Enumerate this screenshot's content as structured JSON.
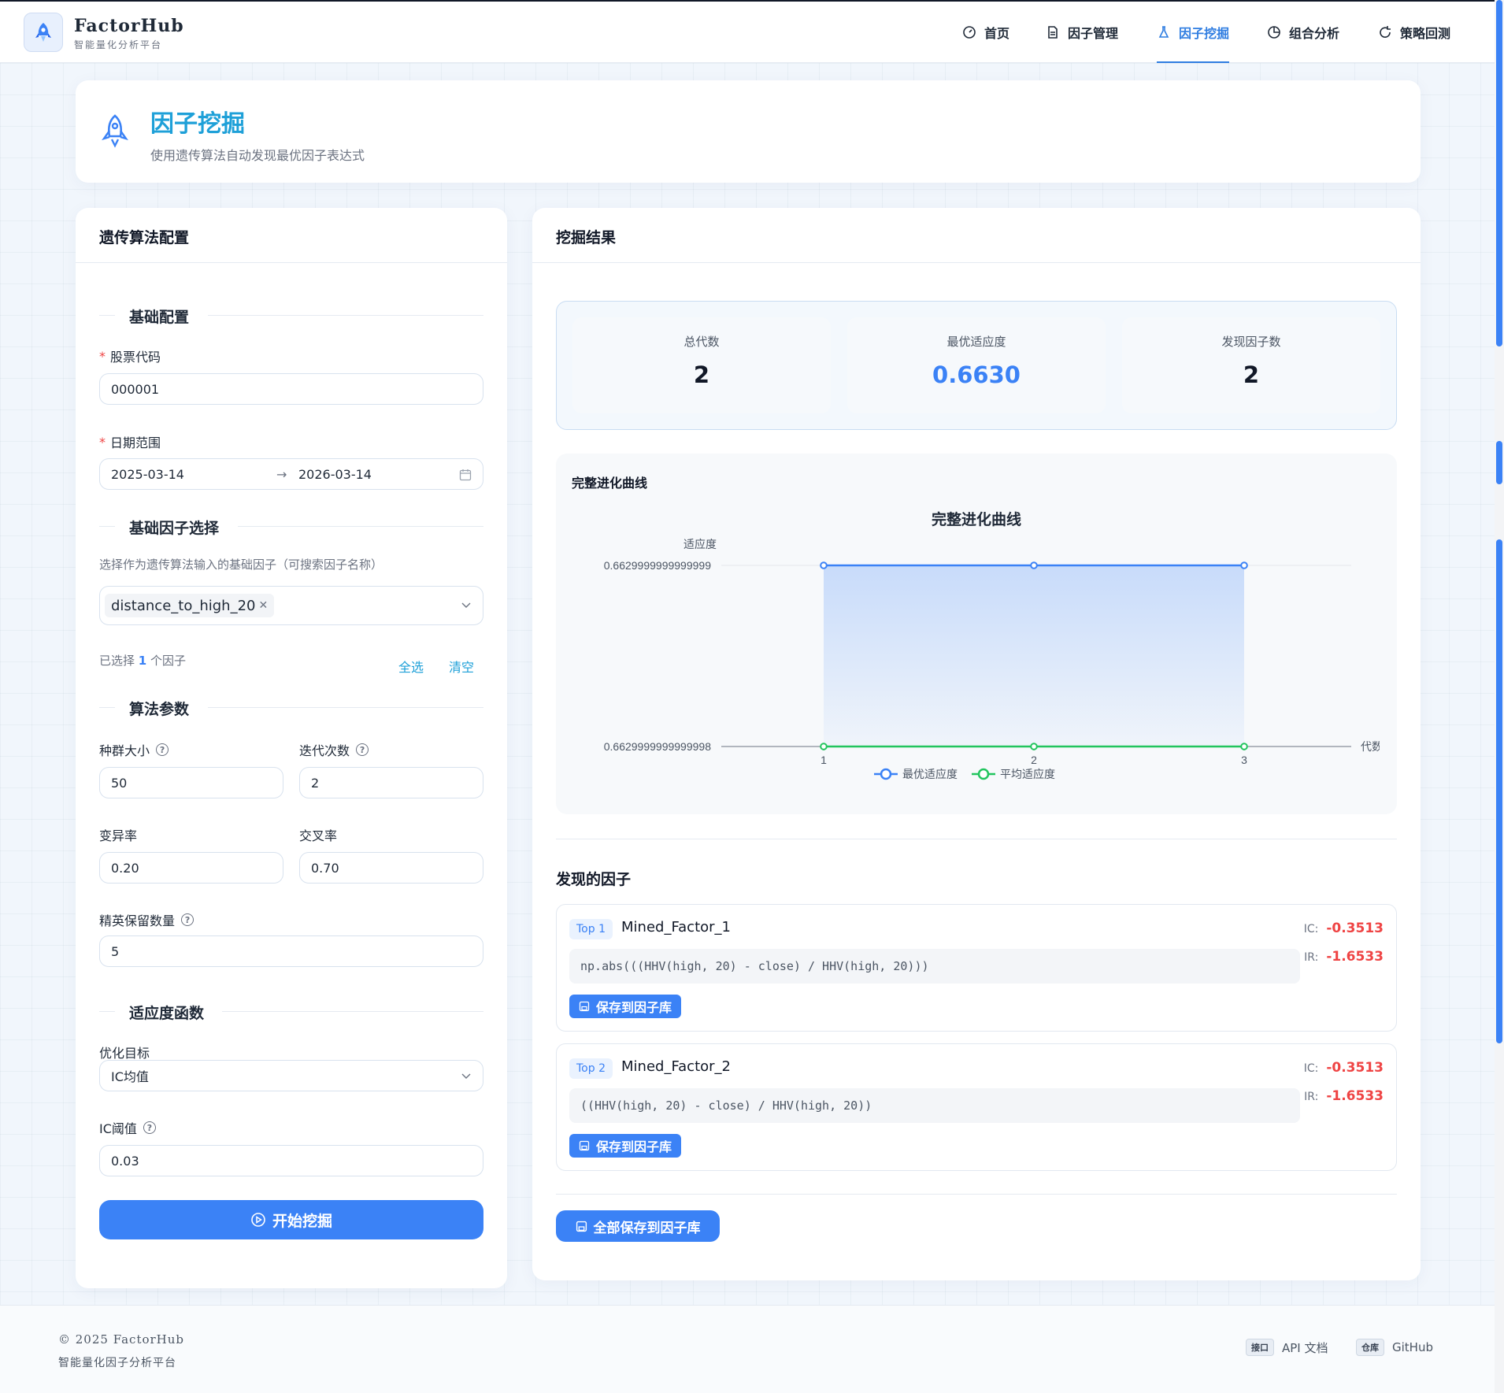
{
  "brand": {
    "name": "FactorHub",
    "subtitle": "智能量化分析平台"
  },
  "nav": [
    {
      "label": "首页",
      "icon": "dashboard-icon",
      "active": false
    },
    {
      "label": "因子管理",
      "icon": "document-icon",
      "active": false
    },
    {
      "label": "因子挖掘",
      "icon": "flask-icon",
      "active": true
    },
    {
      "label": "组合分析",
      "icon": "pie-chart-icon",
      "active": false
    },
    {
      "label": "策略回测",
      "icon": "refresh-icon",
      "active": false
    }
  ],
  "page": {
    "title": "因子挖掘",
    "subtitle": "使用遗传算法自动发现最优因子表达式"
  },
  "config": {
    "header": "遗传算法配置",
    "basic_section": "基础配置",
    "stock_code_label": "股票代码",
    "stock_code_value": "000001",
    "date_range_label": "日期范围",
    "date_start": "2025-03-14",
    "date_end": "2026-03-14",
    "date_sep": "→",
    "factor_section": "基础因子选择",
    "factor_hint": "选择作为遗传算法输入的基础因子（可搜索因子名称）",
    "selected_factor": "distance_to_high_20",
    "selected_prefix": "已选择",
    "selected_count": "1",
    "selected_suffix": "个因子",
    "select_all": "全选",
    "clear": "清空",
    "algo_section": "算法参数",
    "population_label": "种群大小",
    "population_value": "50",
    "iterations_label": "迭代次数",
    "iterations_value": "2",
    "mutation_label": "变异率",
    "mutation_value": "0.20",
    "crossover_label": "交叉率",
    "crossover_value": "0.70",
    "elite_label": "精英保留数量",
    "elite_value": "5",
    "fitness_section": "适应度函数",
    "objective_label": "优化目标",
    "objective_value": "IC均值",
    "ic_threshold_label": "IC阈值",
    "ic_threshold_value": "0.03",
    "start_button": "开始挖掘"
  },
  "results": {
    "header": "挖掘结果",
    "stats": [
      {
        "label": "总代数",
        "value": "2"
      },
      {
        "label": "最优适应度",
        "value": "0.6630"
      },
      {
        "label": "发现因子数",
        "value": "2"
      }
    ],
    "chart_card_title": "完整进化曲线",
    "discovered_title": "发现的因子",
    "save_label": "保存到因子库",
    "save_all_label": "全部保存到因子库",
    "factors": [
      {
        "rank": "Top 1",
        "name": "Mined_Factor_1",
        "expr": "np.abs(((HHV(high, 20) - close) / HHV(high, 20)))",
        "ic_label": "IC:",
        "ic": "-0.3513",
        "ir_label": "IR:",
        "ir": "-1.6533"
      },
      {
        "rank": "Top 2",
        "name": "Mined_Factor_2",
        "expr": "((HHV(high, 20) - close) / HHV(high, 20))",
        "ic_label": "IC:",
        "ic": "-0.3513",
        "ir_label": "IR:",
        "ir": "-1.6533"
      }
    ]
  },
  "chart_data": {
    "type": "line",
    "title": "完整进化曲线",
    "xlabel": "代数",
    "ylabel": "适应度",
    "categories": [
      "1",
      "2",
      "3"
    ],
    "y_ticks": [
      "0.6629999999999998",
      "0.6629999999999999"
    ],
    "series": [
      {
        "name": "最优适应度",
        "values": [
          0.6629999999999999,
          0.6629999999999999,
          0.6629999999999999
        ],
        "color": "#3b82f6",
        "area": true
      },
      {
        "name": "平均适应度",
        "values": [
          0.6629999999999998,
          0.6629999999999998,
          0.6629999999999998
        ],
        "color": "#22c55e",
        "area": false
      }
    ],
    "legend": "bottom-center",
    "grid": true
  },
  "footer": {
    "copyright": "© 2025 FactorHub",
    "subtitle": "智能量化因子分析平台",
    "links": [
      {
        "chip": "接口",
        "label": "API 文档"
      },
      {
        "chip": "仓库",
        "label": "GitHub"
      }
    ]
  },
  "colors": {
    "accent": "#3b82f6",
    "title_cyan": "#1ea0d8",
    "negative": "#ef4444",
    "avg_series": "#22c55e"
  }
}
